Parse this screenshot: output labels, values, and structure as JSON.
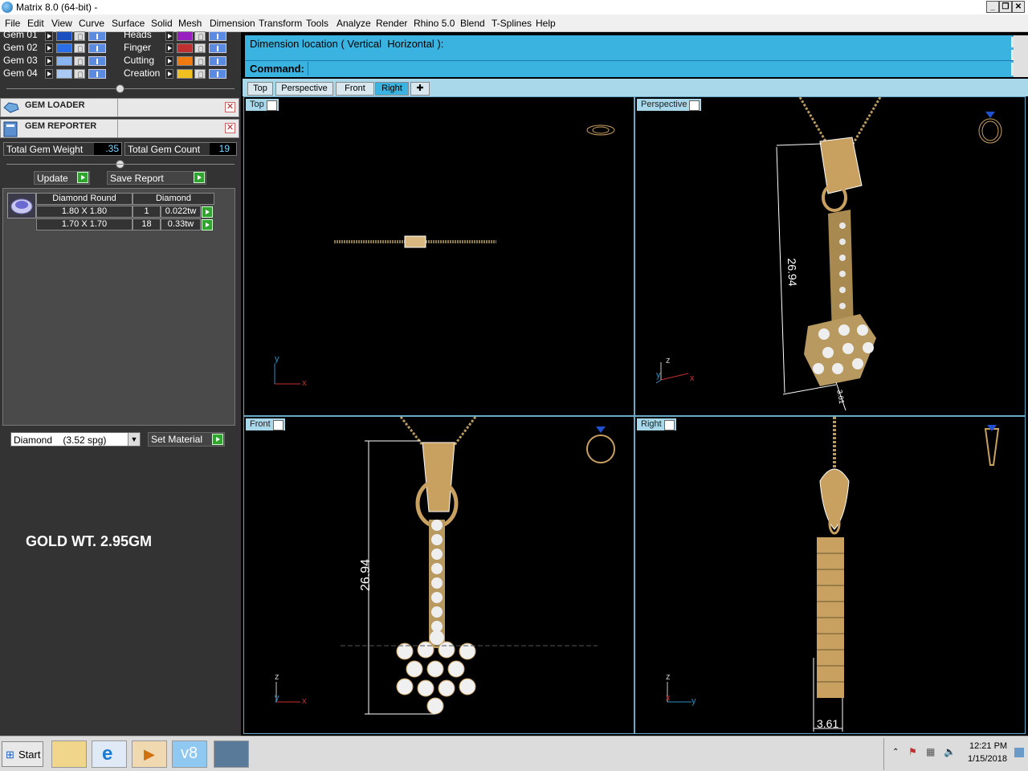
{
  "window": {
    "title": "Matrix 8.0 (64-bit) -"
  },
  "menu": [
    "File",
    "Edit",
    "View",
    "Curve",
    "Surface",
    "Solid",
    "Mesh",
    "Dimension",
    "Transform",
    "Tools",
    "Analyze",
    "Render",
    "Rhino 5.0",
    "Blend",
    "T-Splines",
    "Help"
  ],
  "layers_left": [
    {
      "name": "Gem 01",
      "color": "#1a4fc0"
    },
    {
      "name": "Gem 02",
      "color": "#2a6ee8"
    },
    {
      "name": "Gem 03",
      "color": "#88b4f0"
    },
    {
      "name": "Gem 04",
      "color": "#aac8f4"
    }
  ],
  "layers_right": [
    {
      "name": "Heads",
      "color": "#9a1fc0"
    },
    {
      "name": "Finger",
      "color": "#c03030"
    },
    {
      "name": "Cutting",
      "color": "#f07a10"
    },
    {
      "name": "Creation",
      "color": "#f0c020"
    }
  ],
  "gem_loader": {
    "title": "GEM LOADER"
  },
  "gem_reporter": {
    "title": "GEM REPORTER",
    "total_weight_label": "Total Gem Weight",
    "total_weight": ".35",
    "total_count_label": "Total Gem Count",
    "total_count": "19",
    "update_label": "Update",
    "save_label": "Save Report"
  },
  "gem_table": {
    "headers": [
      "Diamond Round",
      "Diamond"
    ],
    "rows": [
      {
        "size": "1.80 X 1.80",
        "count": "1",
        "weight": "0.022tw"
      },
      {
        "size": "1.70 X 1.70",
        "count": "18",
        "weight": "0.33tw"
      }
    ]
  },
  "material": {
    "selected": "Diamond    (3.52 spg)",
    "set_label": "Set Material"
  },
  "gold_weight": "GOLD WT. 2.95GM",
  "command": {
    "prompt": "Dimension location ( Vertical  Horizontal ):",
    "label": "Command:"
  },
  "viewport_tabs": [
    "Top",
    "Perspective",
    "Front",
    "Right"
  ],
  "viewports": {
    "top": "Top",
    "perspective": "Perspective",
    "front": "Front",
    "right": "Right"
  },
  "dimensions": {
    "height": "26.94",
    "depth": "3.61",
    "persp_small": "3.61"
  },
  "axes": {
    "x": "x",
    "y": "y",
    "z": "z"
  },
  "taskbar": {
    "start": "Start",
    "time": "12:21 PM",
    "date": "1/15/2018"
  }
}
